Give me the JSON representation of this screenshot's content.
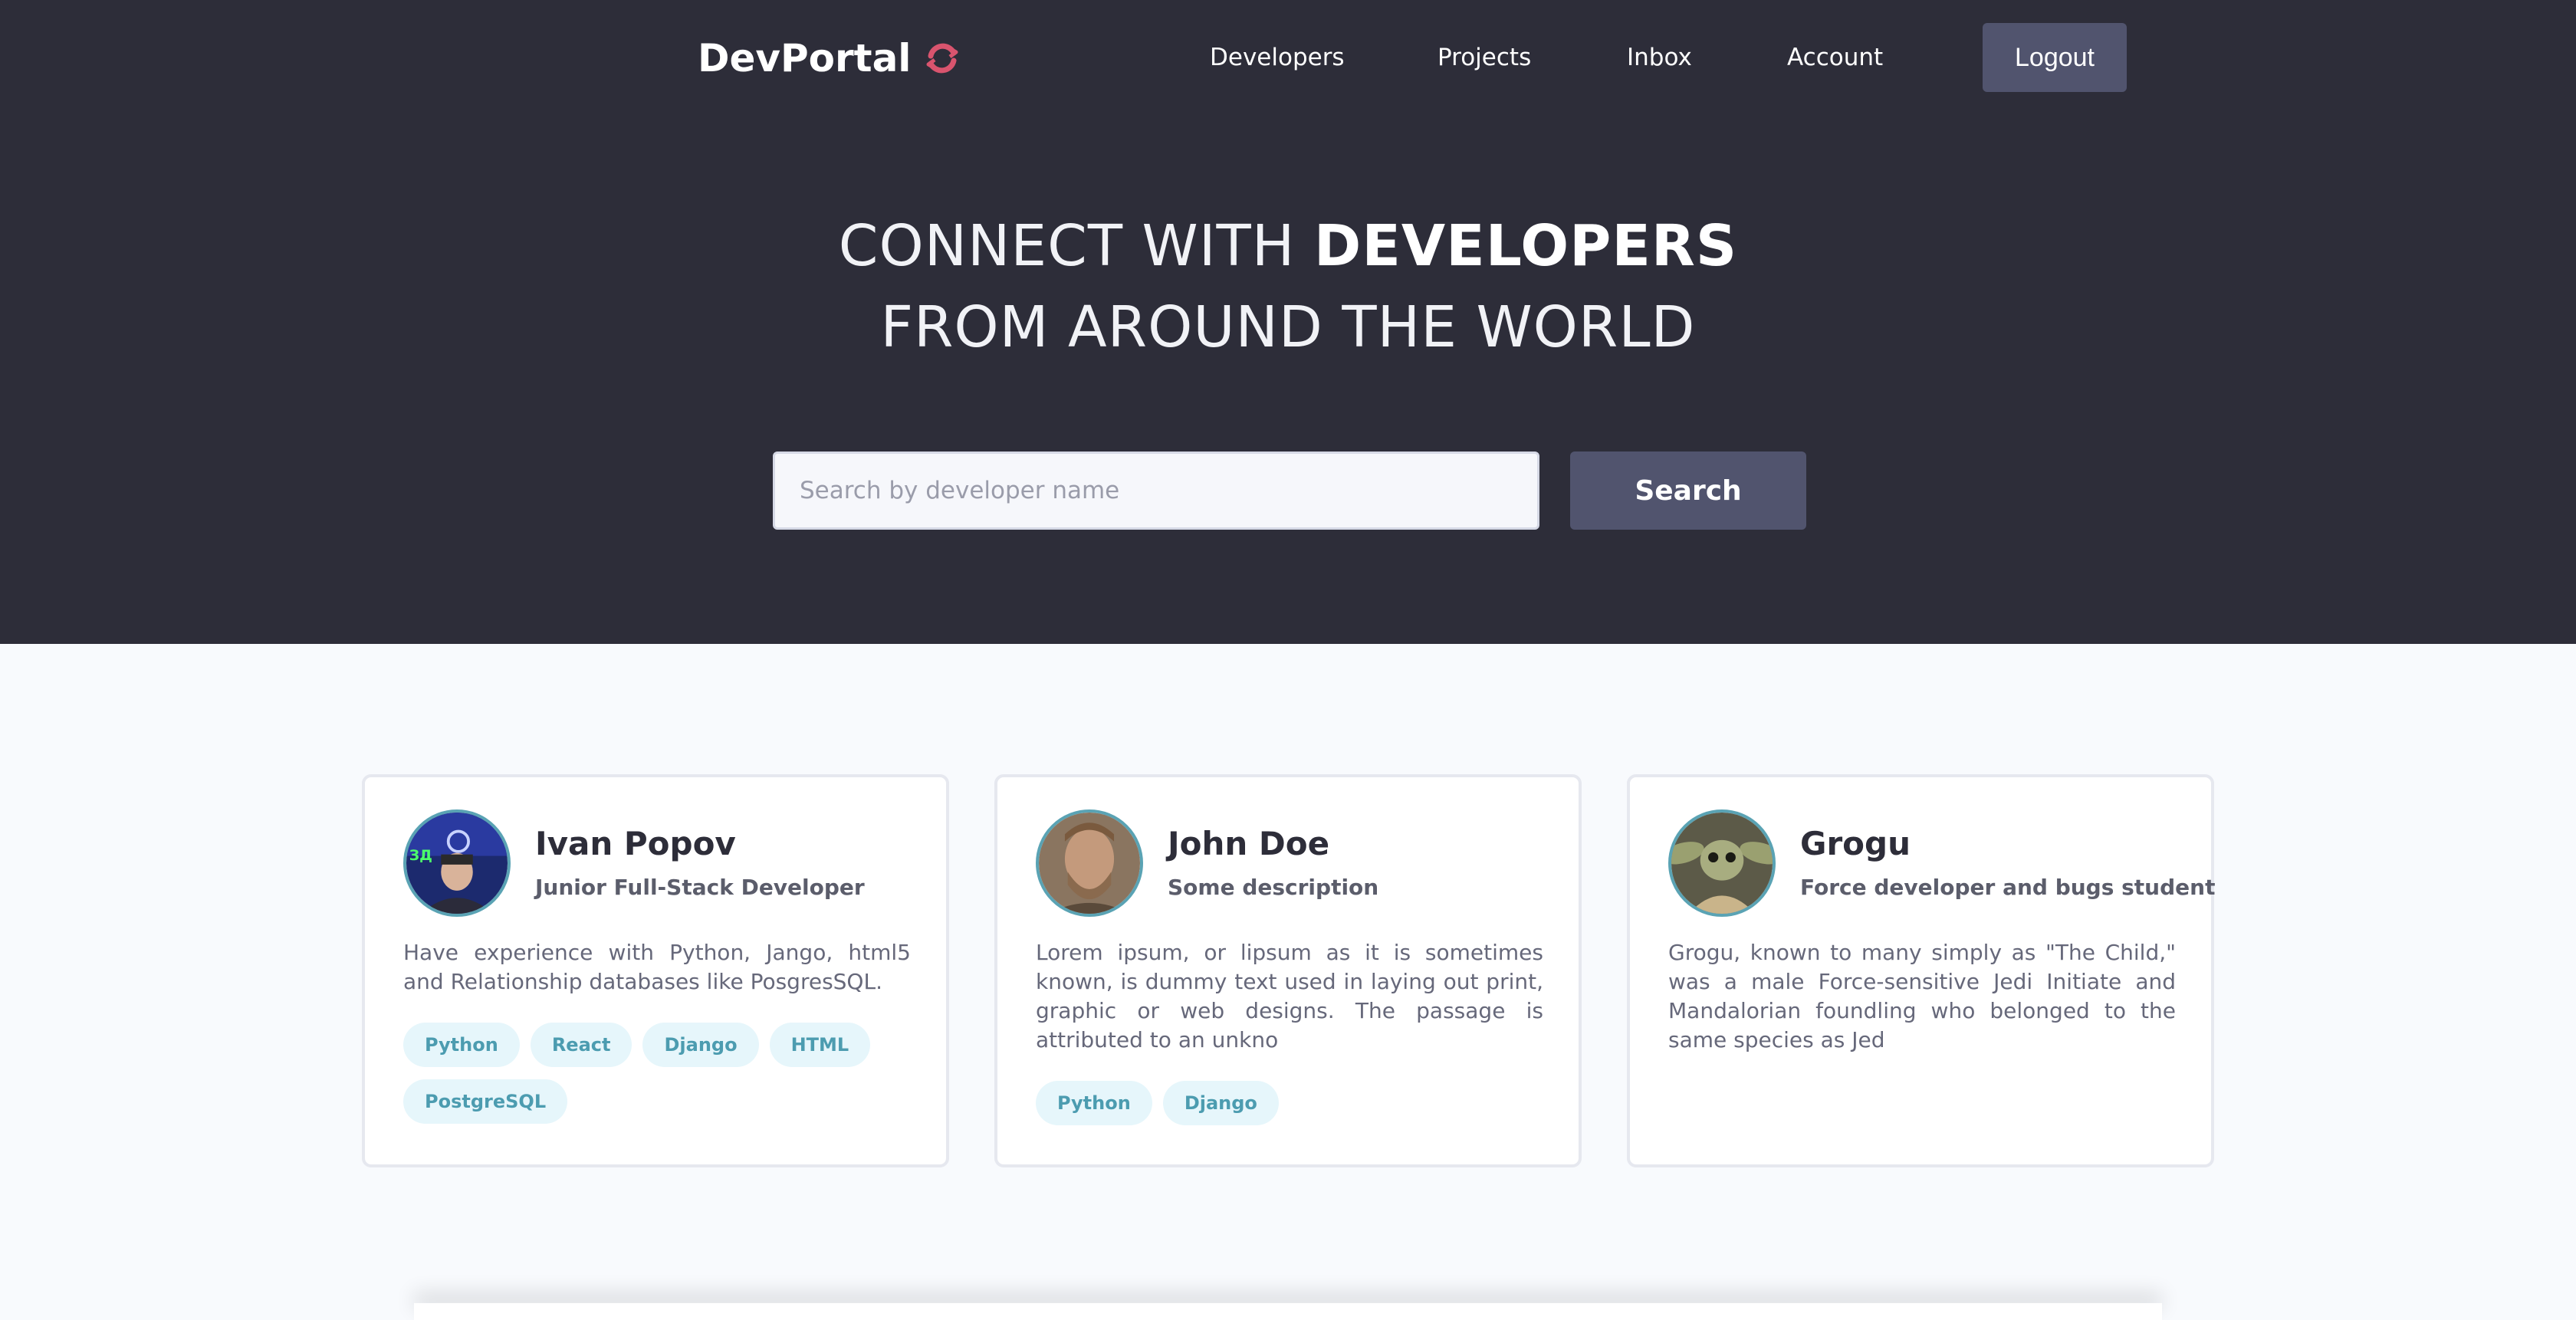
{
  "header": {
    "logo_text": "DevPortal",
    "nav": [
      "Developers",
      "Projects",
      "Inbox",
      "Account"
    ],
    "logout_label": "Logout"
  },
  "hero": {
    "line1_light": "CONNECT WITH ",
    "line1_bold": "DEVELOPERS",
    "line2": "FROM AROUND THE WORLD"
  },
  "search": {
    "placeholder": "Search by developer name",
    "button_label": "Search"
  },
  "developers": [
    {
      "name": "Ivan Popov",
      "role": "Junior Full-Stack Developer",
      "bio": "Have experience with Python, Jango, html5 and Relationship databases like PosgresSQL.",
      "skills": [
        "Python",
        "React",
        "Django",
        "HTML",
        "PostgreSQL"
      ]
    },
    {
      "name": "John Doe",
      "role": "Some description",
      "bio": "Lorem ipsum, or lipsum as it is sometimes known, is dummy text used in laying out print, graphic or web designs. The passage is attributed to an unkno",
      "skills": [
        "Python",
        "Django"
      ]
    },
    {
      "name": "Grogu",
      "role": "Force developer and bugs student",
      "bio": "Grogu, known to many simply as \"The Child,\" was a male Force-sensitive Jedi Initiate and Mandalorian foundling who belonged to the same species as Jed",
      "skills": []
    }
  ],
  "colors": {
    "hero_bg": "#2d2d39",
    "button_bg": "#51546e",
    "logo_accent": "#d9546e",
    "skill_bg": "#e6f6fb",
    "skill_text": "#4c9cb0"
  }
}
